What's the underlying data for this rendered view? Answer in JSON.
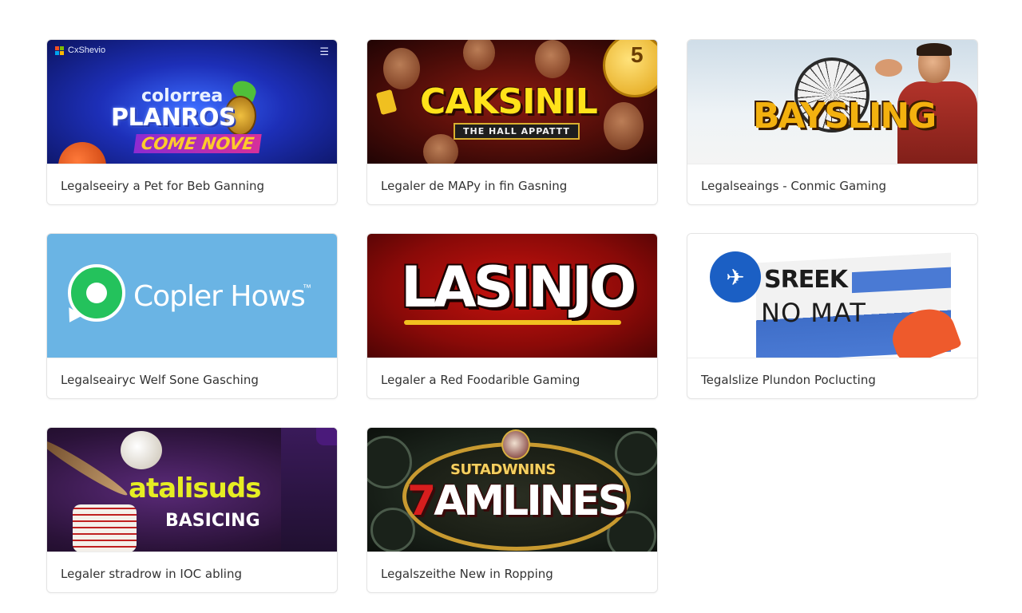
{
  "cards": [
    {
      "caption": "Legalseeiry a Pet for Beb Ganning",
      "banner": {
        "brand": "CxShevio",
        "line1": "colorrea",
        "line2": "PLANROS",
        "line3": "COME NOVE"
      }
    },
    {
      "caption": "Legaler de MAPy in fin Gasning",
      "banner": {
        "title": "CAKSINIL",
        "subtitle": "THE HALL APPATTT",
        "coin": "5"
      }
    },
    {
      "caption": "Legalseaings - Conmic Gaming",
      "banner": {
        "title": "BAYSLING"
      }
    },
    {
      "caption": "Legalseairyc Welf Sone Gasching",
      "banner": {
        "title": "Copler Hows",
        "tm": "™"
      }
    },
    {
      "caption": "Legaler a Red Foodarible Gaming",
      "banner": {
        "title": "LASINJO"
      }
    },
    {
      "caption": "Tegalslize Plundon Poclucting",
      "banner": {
        "title1": "SREEK",
        "title2": "NO MAT"
      }
    },
    {
      "caption": "Legaler stradrow in IOC abling",
      "banner": {
        "title1": "atalisuds",
        "title2": "BASICING"
      }
    },
    {
      "caption": "Legalszeithe New in Ropping",
      "banner": {
        "title1": "SUTADWNINS",
        "title2_seven": "7",
        "title2_rest": "AMLINES"
      }
    }
  ],
  "icons": {
    "menu": "hamburger-menu-icon",
    "brand": "windows-logo-icon",
    "chat": "whatsapp-icon",
    "plane": "airplane-icon"
  },
  "colors": {
    "page_bg": "#ffffff",
    "card_border": "#e4e4e4",
    "caption_text": "#333333"
  }
}
